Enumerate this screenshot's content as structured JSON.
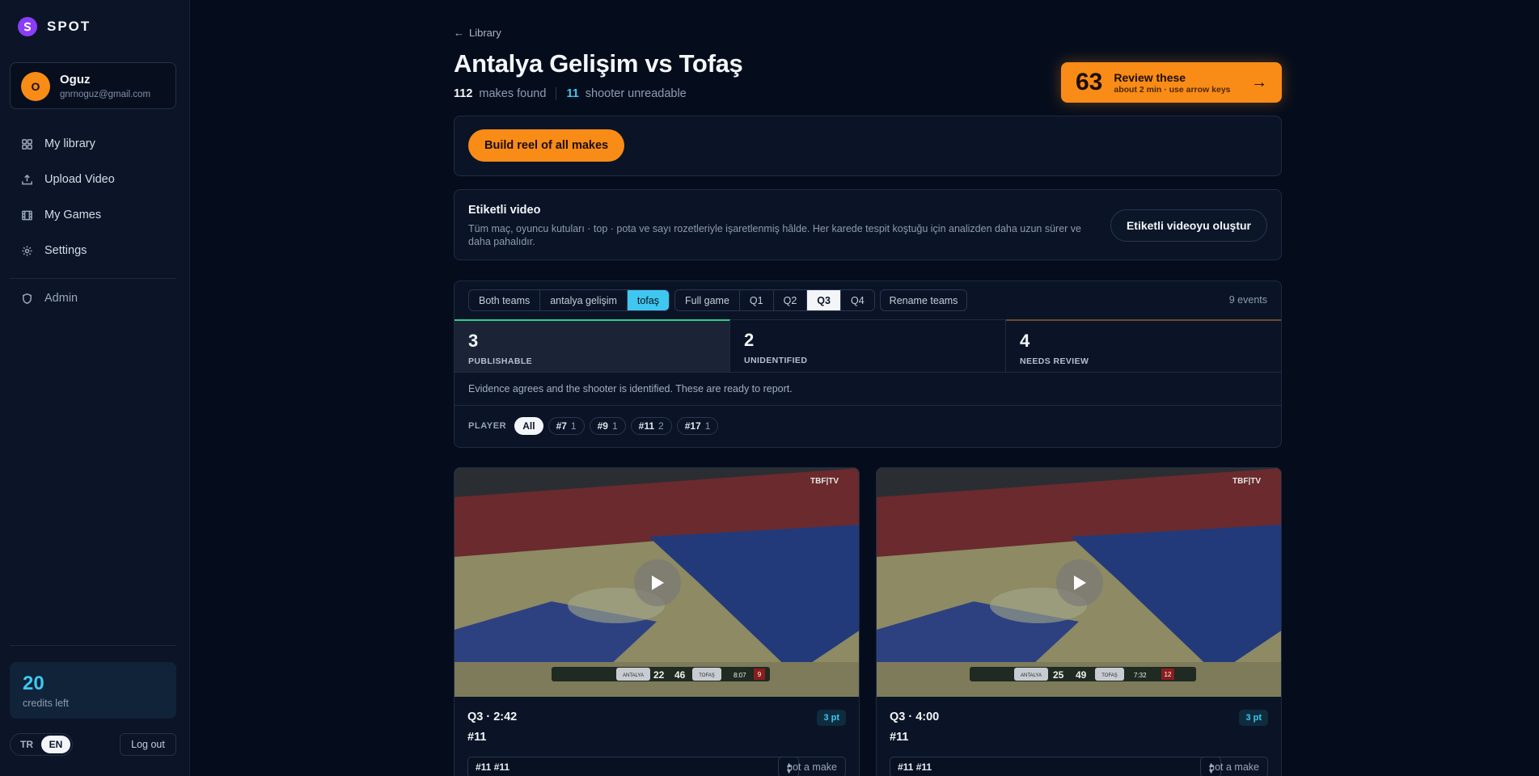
{
  "brand": {
    "name": "SPOT"
  },
  "user": {
    "initial": "O",
    "name": "Oguz",
    "email": "gnrnoguz@gmail.com"
  },
  "nav": {
    "items": [
      {
        "label": "My library",
        "icon": "grid-icon"
      },
      {
        "label": "Upload Video",
        "icon": "upload-icon"
      },
      {
        "label": "My Games",
        "icon": "film-icon"
      },
      {
        "label": "Settings",
        "icon": "gear-icon"
      }
    ],
    "admin": {
      "label": "Admin",
      "icon": "shield-icon"
    }
  },
  "credits": {
    "count": "20",
    "label": "credits left"
  },
  "language": {
    "options": [
      "TR",
      "EN"
    ],
    "selected": "EN"
  },
  "logout_label": "Log out",
  "breadcrumb": {
    "back_label": "Library",
    "arrow": "←"
  },
  "game": {
    "title": "Antalya Gelişim vs Tofaş",
    "makes_found_count": "112",
    "makes_found_label": "makes found",
    "unreadable_count": "11",
    "unreadable_label": "shooter unreadable"
  },
  "review_cta": {
    "count": "63",
    "title": "Review these",
    "subtitle": "about 2 min · use arrow keys",
    "arrow": "→"
  },
  "build_reel_label": "Build reel of all makes",
  "tagged_video": {
    "title": "Etiketli video",
    "description": "Tüm maç, oyuncu kutuları · top · pota ve sayı rozetleriyle işaretlenmiş hâlde. Her karede tespit koştuğu için analizden daha uzun sürer ve daha pahalıdır.",
    "button_label": "Etiketli videoyu oluştur"
  },
  "filters": {
    "teams": [
      "Both teams",
      "antalya gelişim",
      "tofaş"
    ],
    "team_selected": "tofaş",
    "periods": [
      "Full game",
      "Q1",
      "Q2",
      "Q3",
      "Q4"
    ],
    "period_selected": "Q3",
    "rename_label": "Rename teams",
    "events_count": "9 events"
  },
  "stat_tabs": [
    {
      "count": "3",
      "label": "PUBLISHABLE",
      "status_color": "#2ecf8a"
    },
    {
      "count": "2",
      "label": "UNIDENTIFIED"
    },
    {
      "count": "4",
      "label": "NEEDS REVIEW"
    }
  ],
  "evidence_text": "Evidence agrees and the shooter is identified. These are ready to report.",
  "player_filter": {
    "label": "PLAYER",
    "all_label": "All",
    "chips": [
      {
        "number": "#7",
        "count": "1"
      },
      {
        "number": "#9",
        "count": "1"
      },
      {
        "number": "#11",
        "count": "2"
      },
      {
        "number": "#17",
        "count": "1"
      }
    ]
  },
  "clips": [
    {
      "time": "Q3 · 2:42",
      "player": "#11",
      "points": "3 pt",
      "select_value": "#11 #11",
      "not_make_label": "not a make",
      "scoreboard": {
        "home_team": "ANTALYA",
        "home_score": "22",
        "away_score": "46",
        "away_team": "TOFAŞ",
        "clock": "8:07",
        "shot_clock": "9"
      },
      "watermark": "TBF|TV"
    },
    {
      "time": "Q3 · 4:00",
      "player": "#11",
      "points": "3 pt",
      "select_value": "#11 #11",
      "not_make_label": "not a make",
      "scoreboard": {
        "home_team": "ANTALYA",
        "home_score": "25",
        "away_score": "49",
        "away_team": "TOFAŞ",
        "clock": "7:32",
        "shot_clock": "12"
      },
      "watermark": "TBF|TV"
    }
  ],
  "colors": {
    "accent_orange": "#f98b17",
    "accent_cyan": "#3fc7f0",
    "brand_purple": "#8b3df5",
    "background": "#050d1c"
  }
}
